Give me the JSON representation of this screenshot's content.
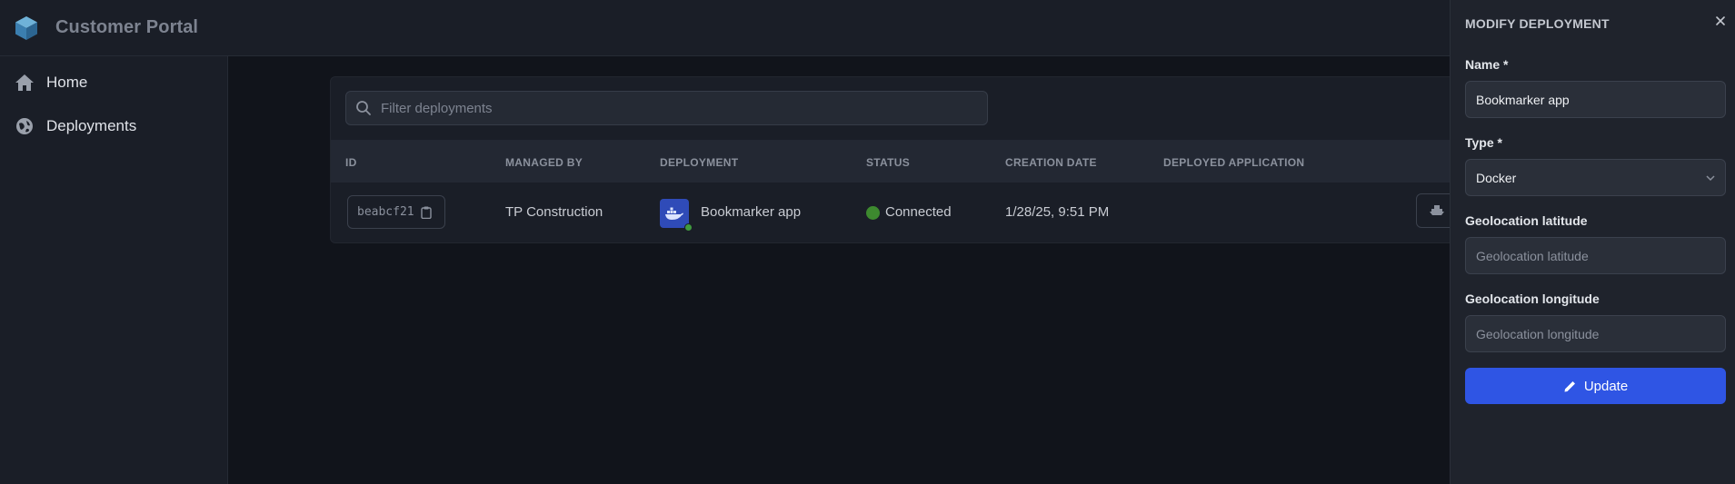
{
  "app": {
    "title": "Customer Portal",
    "logo_icon": "cube-logo-icon"
  },
  "sidebar": {
    "items": [
      {
        "label": "Home",
        "icon": "home-icon"
      },
      {
        "label": "Deployments",
        "icon": "deployments-icon"
      }
    ]
  },
  "search": {
    "placeholder": "Filter deployments",
    "value": ""
  },
  "table": {
    "columns": [
      "ID",
      "MANAGED BY",
      "DEPLOYMENT",
      "STATUS",
      "CREATION DATE",
      "DEPLOYED APPLICATION"
    ],
    "rows": [
      {
        "id": "beabcf21",
        "managed_by": "TP Construction",
        "deployment": "Bookmarker app",
        "deployment_icon": "docker-icon",
        "status": "Connected",
        "status_color": "#3d8a2f",
        "creation_date": "1/28/25, 9:51 PM",
        "deployed_application": ""
      }
    ]
  },
  "drawer": {
    "title": "MODIFY DEPLOYMENT",
    "fields": {
      "name": {
        "label": "Name *",
        "value": "Bookmarker app"
      },
      "type": {
        "label": "Type *",
        "value": "Docker"
      },
      "latitude": {
        "label": "Geolocation latitude",
        "placeholder": "Geolocation latitude",
        "value": ""
      },
      "longitude": {
        "label": "Geolocation longitude",
        "placeholder": "Geolocation longitude",
        "value": ""
      }
    },
    "submit_label": "Update"
  },
  "colors": {
    "accent": "#2f55e4",
    "background": "#11141b",
    "panel": "#1a1e27",
    "status_connected": "#3d8a2f"
  }
}
